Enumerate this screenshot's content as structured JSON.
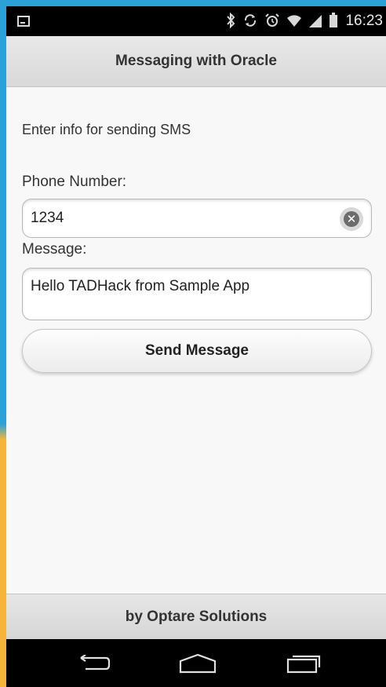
{
  "status_bar": {
    "time": "16:23",
    "icons": [
      "notification-icon",
      "bluetooth-icon",
      "sync-icon",
      "alarm-icon",
      "wifi-icon",
      "signal-icon",
      "battery-icon"
    ]
  },
  "header": {
    "title": "Messaging with Oracle"
  },
  "form": {
    "intro": "Enter info for sending SMS",
    "phone_label": "Phone Number:",
    "phone_value": "1234",
    "message_label": "Message:",
    "message_value": "Hello TADHack from Sample App",
    "send_label": "Send Message"
  },
  "footer": {
    "text": "by Optare Solutions"
  },
  "navbar": {
    "buttons": [
      "back-icon",
      "home-icon",
      "recent-apps-icon"
    ]
  },
  "colors": {
    "frame_top": "#2aa2d8",
    "frame_bottom": "#f4b638",
    "toolbar": "#e0e0e0",
    "background": "#f8f8f8"
  }
}
